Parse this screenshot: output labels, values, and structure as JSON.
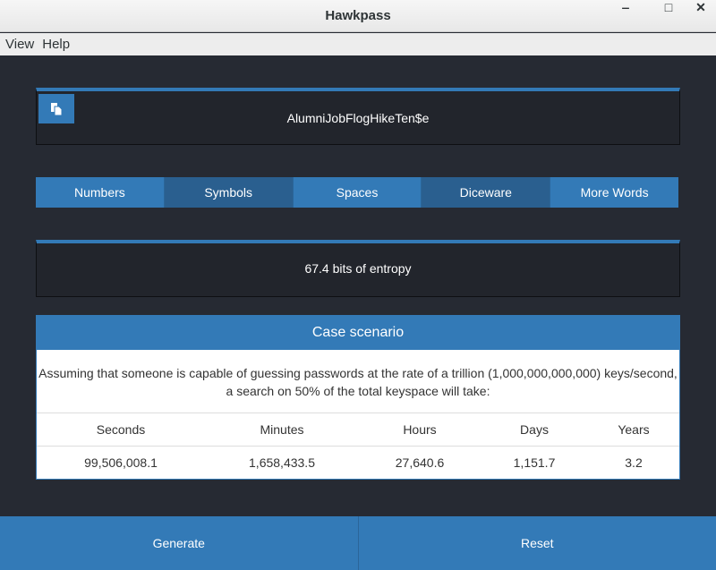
{
  "window": {
    "title": "Hawkpass"
  },
  "menu": [
    "View",
    "Help"
  ],
  "password": {
    "value": "AlumniJobFlogHikeTen$e",
    "copy_icon": "copy-icon"
  },
  "toggles": [
    {
      "label": "Numbers",
      "active": false
    },
    {
      "label": "Symbols",
      "active": true
    },
    {
      "label": "Spaces",
      "active": false
    },
    {
      "label": "Diceware",
      "active": true
    },
    {
      "label": "More Words",
      "active": false
    }
  ],
  "entropy": "67.4 bits of entropy",
  "case": {
    "title": "Case scenario",
    "description": "Assuming that someone is capable of guessing passwords at the rate of a trillion (1,000,000,000,000) keys/second, a search on 50% of the total keyspace will take:",
    "headers": [
      "Seconds",
      "Minutes",
      "Hours",
      "Days",
      "Years"
    ],
    "values": [
      "99,506,008.1",
      "1,658,433.5",
      "27,640.6",
      "1,151.7",
      "3.2"
    ]
  },
  "buttons": {
    "generate": "Generate",
    "reset": "Reset"
  },
  "colors": {
    "accent": "#337ab7",
    "active_toggle": "#2a5f8f",
    "background": "#262a33"
  }
}
